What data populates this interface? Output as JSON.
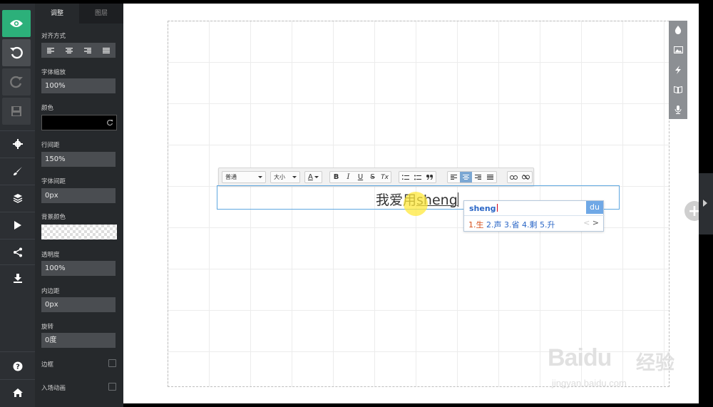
{
  "panel": {
    "tabs": [
      {
        "label": "调整"
      },
      {
        "label": "图层"
      }
    ],
    "align_label": "对齐方式",
    "font_scale_label": "字体缩放",
    "font_scale_value": "100%",
    "color_label": "颜色",
    "color_value": "#000000",
    "line_height_label": "行间距",
    "line_height_value": "150%",
    "letter_spacing_label": "字体间距",
    "letter_spacing_value": "0px",
    "bg_color_label": "背景颜色",
    "opacity_label": "透明度",
    "opacity_value": "100%",
    "padding_label": "内边距",
    "padding_value": "0px",
    "rotate_label": "旋转",
    "rotate_value": "0度",
    "border_label": "边框",
    "entry_anim_label": "入场动画"
  },
  "toolbar": {
    "paragraph_select": "普通",
    "size_select": "大小",
    "font_color_icon": "A",
    "bold": "B",
    "italic": "I",
    "underline": "U",
    "strike": "S",
    "clear_format": "Tx"
  },
  "editor": {
    "text_committed": "我爱用",
    "text_composing": "sheng"
  },
  "ime": {
    "input": "sheng",
    "logo": "du",
    "candidates": [
      "1.生",
      "2.声",
      "3.省",
      "4.剩",
      "5.升"
    ]
  },
  "watermark": {
    "logo": "Baidu",
    "cn": "经验",
    "url": "jingyan.baidu.com"
  },
  "colors": {
    "accent_green": "#2cb07a",
    "rail_bg": "#2c2f33",
    "panel_bg": "#26292c",
    "text_box_border": "#5fa7e0"
  }
}
